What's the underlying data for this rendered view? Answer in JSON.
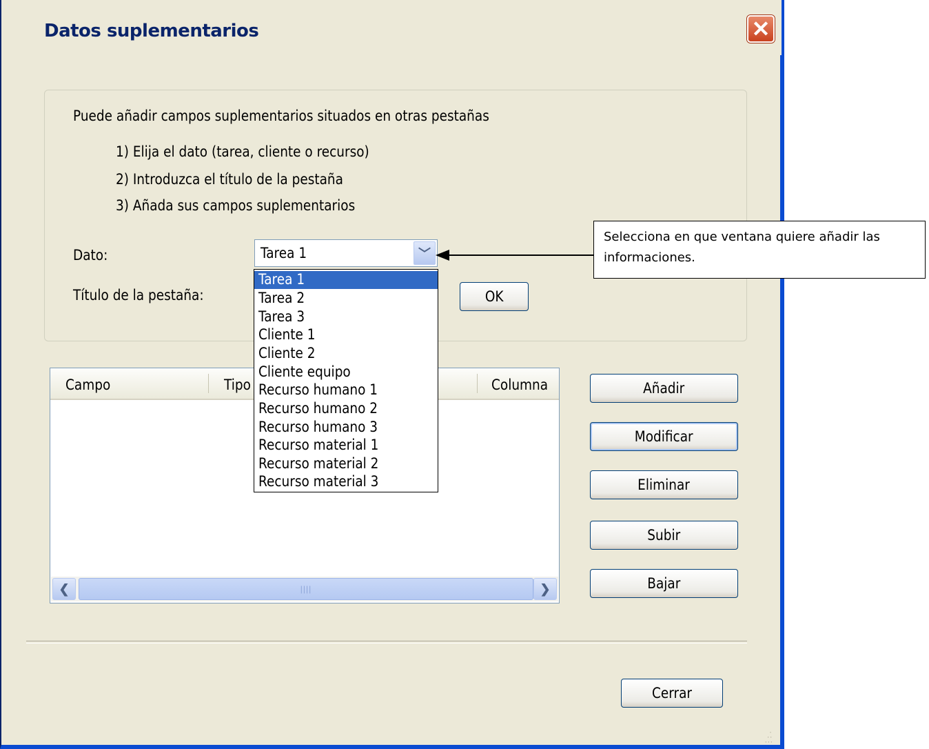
{
  "window": {
    "title": "Datos suplementarios"
  },
  "instructions": {
    "intro": "Puede añadir campos suplementarios situados en otras pestañas",
    "steps": [
      "1) Elija el dato (tarea, cliente o recurso)",
      "2) Introduzca el título de la pestaña",
      "3) Añada sus campos suplementarios"
    ]
  },
  "form": {
    "dato_label": "Dato:",
    "titulo_label": "Título de la pestaña:",
    "dato_selected": "Tarea 1",
    "ok_label": "OK"
  },
  "dropdown": {
    "options": [
      "Tarea 1",
      "Tarea 2",
      "Tarea 3",
      "Cliente 1",
      "Cliente 2",
      "Cliente equipo",
      "Recurso humano 1",
      "Recurso humano 2",
      "Recurso humano 3",
      "Recurso material 1",
      "Recurso material 2",
      "Recurso material 3"
    ],
    "highlighted": "Tarea 1"
  },
  "list": {
    "columns": [
      "Campo",
      "Tipo",
      "Columna"
    ],
    "rows": []
  },
  "buttons": {
    "add": "Añadir",
    "modify": "Modificar",
    "delete": "Eliminar",
    "up": "Subir",
    "down": "Bajar",
    "close": "Cerrar"
  },
  "callout": {
    "text": "Selecciona en que ventana quiere añadir las informaciones."
  },
  "colors": {
    "title_text": "#0a246a",
    "highlight": "#316ac5",
    "window_bg": "#ece9d8"
  }
}
